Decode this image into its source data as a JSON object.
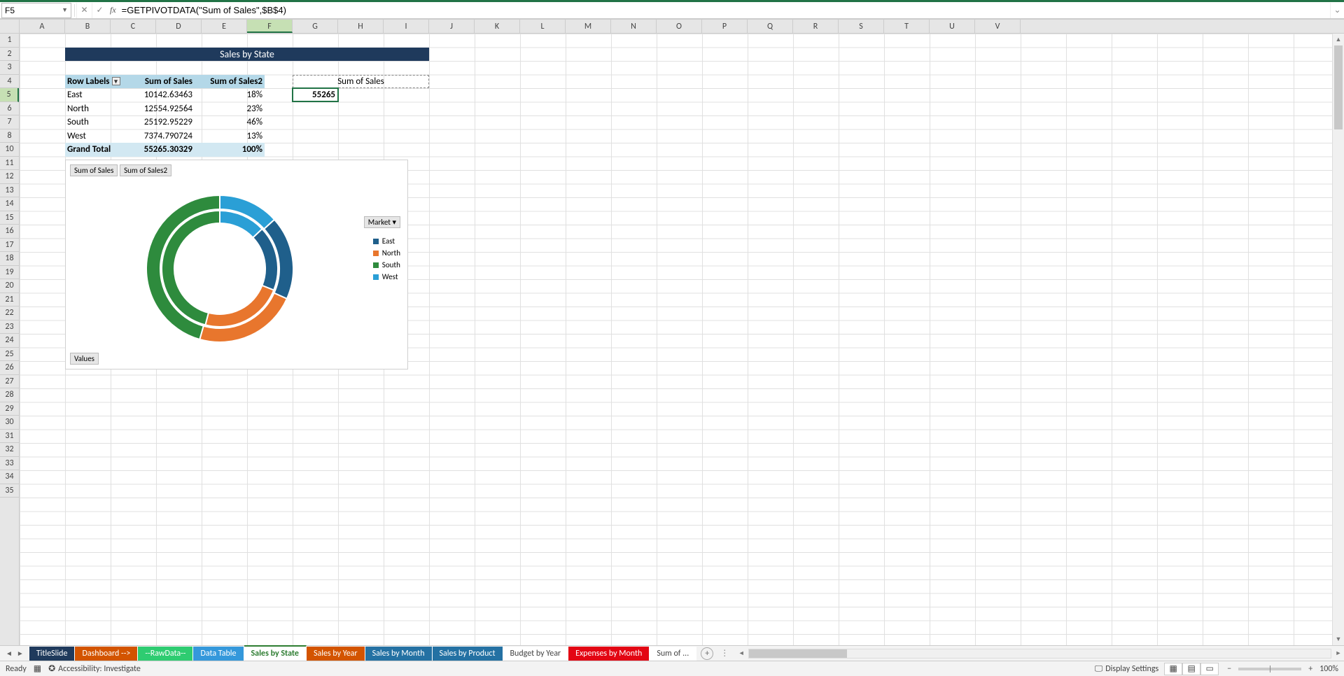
{
  "nameBox": "F5",
  "formula": "=GETPIVOTDATA(\"Sum of Sales\",$B$4)",
  "columns": [
    "A",
    "B",
    "C",
    "D",
    "E",
    "F",
    "G",
    "H",
    "I",
    "J",
    "K",
    "L",
    "M",
    "N",
    "O",
    "P",
    "Q",
    "R",
    "S",
    "T",
    "U",
    "V"
  ],
  "selectedCol": 5,
  "rows": [
    1,
    2,
    3,
    4,
    5,
    6,
    7,
    8,
    10,
    11,
    12,
    13,
    14,
    15,
    16,
    17,
    18,
    19,
    20,
    21,
    22,
    23,
    24,
    25,
    26,
    27,
    28,
    29,
    30,
    31,
    32,
    33,
    34,
    35
  ],
  "selectedRow": 5,
  "titleCell": "Sales by State",
  "pivot": {
    "header": [
      "Row Labels",
      "Sum of Sales",
      "Sum of Sales2"
    ],
    "rows": [
      {
        "label": "East",
        "v1": "10142.63463",
        "v2": "18%"
      },
      {
        "label": "North",
        "v1": "12554.92564",
        "v2": "23%"
      },
      {
        "label": "South",
        "v1": "25192.95229",
        "v2": "46%"
      },
      {
        "label": "West",
        "v1": "7374.790724",
        "v2": "13%"
      }
    ],
    "total": {
      "label": "Grand Total",
      "v1": "55265.30329",
      "v2": "100%"
    }
  },
  "sideLabel": "Sum of Sales",
  "sideValue": "55265",
  "chart": {
    "btn1": "Sum of Sales",
    "btn2": "Sum of Sales2",
    "valuesBtn": "Values",
    "marketBtn": "Market",
    "legend": [
      {
        "name": "East",
        "color": "#1f5f8b"
      },
      {
        "name": "North",
        "color": "#e8762d"
      },
      {
        "name": "South",
        "color": "#2e8b3d"
      },
      {
        "name": "West",
        "color": "#2a9fd6"
      }
    ]
  },
  "chart_data": {
    "type": "pie",
    "title": "Sales by State",
    "series": [
      {
        "name": "Sum of Sales",
        "values": [
          10142.63,
          12554.93,
          25192.95,
          7374.79
        ]
      },
      {
        "name": "Sum of Sales2",
        "values": [
          18,
          23,
          46,
          13
        ]
      }
    ],
    "categories": [
      "East",
      "North",
      "South",
      "West"
    ],
    "colors": {
      "East": "#1f5f8b",
      "North": "#e8762d",
      "South": "#2e8b3d",
      "West": "#2a9fd6"
    }
  },
  "sheetTabs": [
    {
      "label": "TitleSlide",
      "bg": "#1f3a5c"
    },
    {
      "label": "Dashboard -->",
      "bg": "#d35400"
    },
    {
      "label": "--RawData--",
      "bg": "#2ecc71"
    },
    {
      "label": "Data Table",
      "bg": "#3498db"
    },
    {
      "label": "Sales by State",
      "bg": "#ffffff",
      "active": true
    },
    {
      "label": "Sales by Year",
      "bg": "#d35400"
    },
    {
      "label": "Sales by Month",
      "bg": "#2471a3"
    },
    {
      "label": "Sales by Product",
      "bg": "#2471a3"
    },
    {
      "label": "Budget by Year",
      "bg": "#ffffff",
      "fg": "#444"
    },
    {
      "label": "Expenses by Month",
      "bg": "#e30613"
    },
    {
      "label": "Sum of ...",
      "bg": "#ffffff",
      "fg": "#444"
    }
  ],
  "status": {
    "ready": "Ready",
    "access": "Accessibility: Investigate",
    "display": "Display Settings",
    "zoom": "100%"
  }
}
